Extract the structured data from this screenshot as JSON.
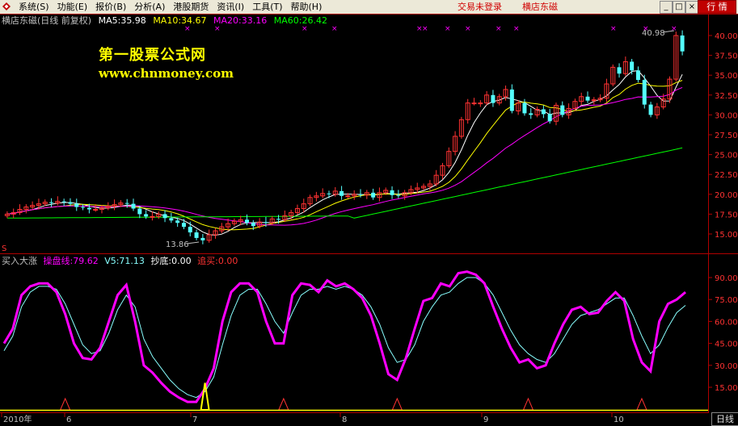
{
  "menu": {
    "items": [
      "系统(S)",
      "功能(E)",
      "报价(B)",
      "分析(A)",
      "港股期货",
      "资讯(I)",
      "工具(T)",
      "帮助(H)"
    ],
    "trade_status": "交易未登录",
    "stock_link": "横店东磁",
    "quote_button": "行 情",
    "min_glyph": "_",
    "restore_glyph": "□",
    "close_glyph": "×"
  },
  "main_chart": {
    "stock_title": "横店东磁(日线 前复权)",
    "ma5": "MA5:35.98",
    "ma10": "MA10:34.67",
    "ma20": "MA20:33.16",
    "ma60": "MA60:26.42",
    "high_marker": "40.98",
    "low_marker": "13.86",
    "s_marker": "S",
    "watermark_title": "第一股票公式网",
    "watermark_url": "www.chnmoney.com",
    "y_ticks": [
      "40.00",
      "37.50",
      "35.00",
      "32.50",
      "30.00",
      "27.50",
      "25.00",
      "22.50",
      "20.00",
      "17.50",
      "15.00"
    ]
  },
  "indicator": {
    "name": "买入大涨",
    "curve_label": "操盘线:79.62",
    "v5_label": "V5:71.13",
    "bottom_label": "抄底:0.00",
    "chase_label": "追买:0.00",
    "y_ticks": [
      "90.00",
      "75.00",
      "60.00",
      "45.00",
      "30.00",
      "15.00"
    ]
  },
  "time_axis": {
    "labels": [
      "2010年",
      "6",
      "7",
      "8",
      "9",
      "10"
    ],
    "period_tab": "日线"
  },
  "colors": {
    "up": "#ff3232",
    "down": "#54ffff",
    "ma5": "#ffffff",
    "ma10": "#ffff00",
    "ma20": "#ff00ff",
    "ma60": "#00ff00",
    "axis": "#b00000",
    "curve": "#ff00ff",
    "v5": "#88ffff"
  },
  "chart_data": [
    {
      "type": "candlestick",
      "title": "横店东磁(日线 前复权)",
      "ylim": [
        13.5,
        41.5
      ],
      "series_names": [
        "MA5",
        "MA10",
        "MA20",
        "MA60"
      ],
      "y": [
        17.5,
        17.7,
        18.1,
        18.4,
        18.6,
        18.8,
        19.0,
        18.9,
        19.1,
        19.0,
        18.8,
        18.4,
        18.3,
        18.1,
        18.1,
        18.3,
        18.5,
        18.7,
        18.9,
        18.8,
        18.2,
        17.5,
        17.2,
        17.2,
        17.5,
        17.0,
        16.7,
        16.4,
        15.9,
        15.2,
        14.5,
        14.2,
        14.9,
        15.4,
        15.9,
        16.3,
        16.6,
        16.8,
        16.4,
        16.0,
        16.5,
        16.4,
        16.9,
        16.8,
        17.3,
        17.7,
        18.2,
        18.8,
        19.6,
        19.8,
        20.1,
        20.0,
        20.4,
        19.8,
        19.8,
        20.0,
        19.9,
        20.2,
        19.6,
        20.2,
        20.5,
        19.9,
        19.8,
        20.2,
        20.6,
        20.8,
        21.0,
        21.3,
        22.4,
        23.6,
        25.4,
        27.3,
        29.4,
        31.5,
        31.5,
        31.5,
        32.5,
        31.5,
        32.3,
        33.2,
        30.5,
        31.5,
        30.2,
        30.0,
        30.7,
        30.1,
        29.2,
        31.2,
        30.0,
        30.8,
        31.7,
        32.3,
        31.8,
        31.9,
        32.1,
        33.9,
        36.0,
        35.2,
        36.7,
        35.6,
        34.4,
        31.3,
        30.0,
        31.0,
        32.0,
        34.5,
        40.0,
        38.0
      ]
    },
    {
      "type": "line",
      "title": "买入大涨",
      "ylim": [
        5,
        100
      ],
      "series": [
        {
          "name": "操盘线",
          "values": [
            45,
            55,
            78,
            84,
            86,
            86,
            80,
            65,
            45,
            35,
            34,
            42,
            60,
            78,
            85,
            60,
            30,
            25,
            18,
            12,
            8,
            5,
            5,
            14,
            28,
            60,
            80,
            86,
            86,
            80,
            60,
            45,
            45,
            78,
            86,
            85,
            80,
            88,
            84,
            86,
            82,
            76,
            64,
            45,
            24,
            20,
            35,
            55,
            74,
            76,
            86,
            84,
            93,
            94,
            92,
            86,
            70,
            55,
            42,
            32,
            34,
            28,
            30,
            45,
            58,
            68,
            70,
            65,
            66,
            74,
            80,
            74,
            48,
            32,
            26,
            60,
            72,
            75,
            80
          ]
        },
        {
          "name": "V5",
          "values": [
            40,
            50,
            70,
            80,
            84,
            84,
            82,
            72,
            58,
            44,
            38,
            40,
            52,
            68,
            78,
            70,
            48,
            36,
            28,
            20,
            14,
            10,
            8,
            12,
            22,
            44,
            64,
            78,
            82,
            82,
            72,
            60,
            52,
            66,
            78,
            82,
            82,
            84,
            82,
            84,
            82,
            78,
            70,
            58,
            42,
            32,
            34,
            44,
            60,
            70,
            78,
            80,
            86,
            90,
            90,
            86,
            78,
            66,
            54,
            44,
            38,
            34,
            32,
            38,
            48,
            58,
            64,
            66,
            68,
            72,
            76,
            76,
            64,
            50,
            38,
            44,
            56,
            66,
            71
          ]
        },
        {
          "name": "抄底",
          "values": [
            0,
            0,
            0,
            0,
            0,
            0,
            0,
            0,
            0,
            0,
            0,
            0,
            0,
            0,
            0,
            0,
            0,
            0,
            0,
            0,
            0,
            0,
            0,
            18,
            0,
            0,
            0,
            0,
            0,
            0,
            0,
            0,
            0,
            0,
            0,
            0,
            0,
            0,
            0,
            0,
            0,
            0,
            0,
            0,
            0,
            0,
            0,
            0,
            0,
            0,
            0,
            0,
            0,
            0,
            0,
            0,
            0,
            0,
            0,
            0,
            0,
            0,
            0,
            0,
            0,
            0,
            0,
            0,
            0,
            0,
            0,
            0,
            0,
            0,
            0,
            0,
            0,
            0,
            0
          ]
        }
      ],
      "signal_markers_at": [
        7,
        32,
        45,
        60,
        73
      ]
    }
  ]
}
